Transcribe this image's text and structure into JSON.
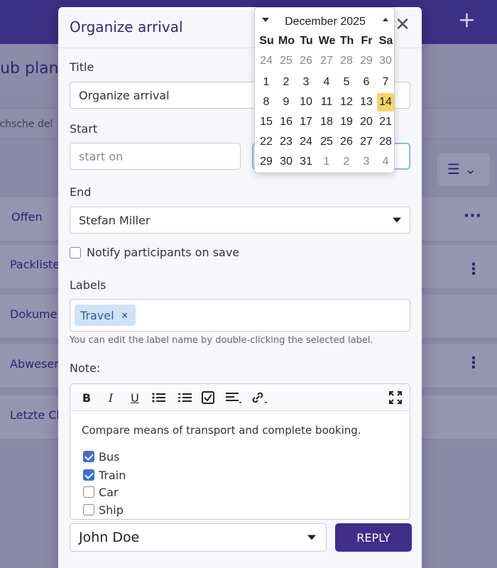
{
  "background": {
    "heading": "lub plane",
    "search_placeholder": "rchsche del",
    "rows": [
      {
        "label": "Offen"
      },
      {
        "label": "Packliste"
      },
      {
        "label": "Dokumen"
      },
      {
        "label": "Abwesen"
      },
      {
        "label": "Letzte Ch"
      }
    ]
  },
  "modal": {
    "title": "Organize arrival",
    "title_label": "Title",
    "title_value": "Organize arrival",
    "start_label": "Start",
    "start_placeholder": "start on",
    "end_label": "End",
    "end_value": "Stefan Miller",
    "notify_label": "Notify participants on save",
    "notify_checked": false,
    "labels_label": "Labels",
    "labels": [
      {
        "name": "Travel"
      }
    ],
    "labels_hint": "You can edit the label name by double-clicking the selected label.",
    "note_label": "Note:",
    "note_text": "Compare means of transport and complete booking.",
    "tasks": [
      {
        "label": "Bus",
        "checked": true
      },
      {
        "label": "Train",
        "checked": true
      },
      {
        "label": "Car",
        "checked": false
      },
      {
        "label": "Ship",
        "checked": false
      }
    ],
    "assignee": "John Doe",
    "reply_label": "REPLY"
  },
  "datepicker": {
    "month": "December 2025",
    "weekdays": [
      "Su",
      "Mo",
      "Tu",
      "We",
      "Th",
      "Fr",
      "Sa"
    ],
    "weeks": [
      [
        "24",
        "25",
        "26",
        "27",
        "28",
        "29",
        "30"
      ],
      [
        "1",
        "2",
        "3",
        "4",
        "5",
        "6",
        "7"
      ],
      [
        "8",
        "9",
        "10",
        "11",
        "12",
        "13",
        "14"
      ],
      [
        "15",
        "16",
        "17",
        "18",
        "19",
        "20",
        "21"
      ],
      [
        "22",
        "23",
        "24",
        "25",
        "26",
        "27",
        "28"
      ],
      [
        "29",
        "30",
        "31",
        "1",
        "2",
        "3",
        "4"
      ]
    ],
    "selected": "14"
  },
  "colors": {
    "accent": "#3f2d8a",
    "selected_day": "#f7d36b",
    "checkbox": "#3b6fd6",
    "tag_bg": "#cfe3f6"
  }
}
